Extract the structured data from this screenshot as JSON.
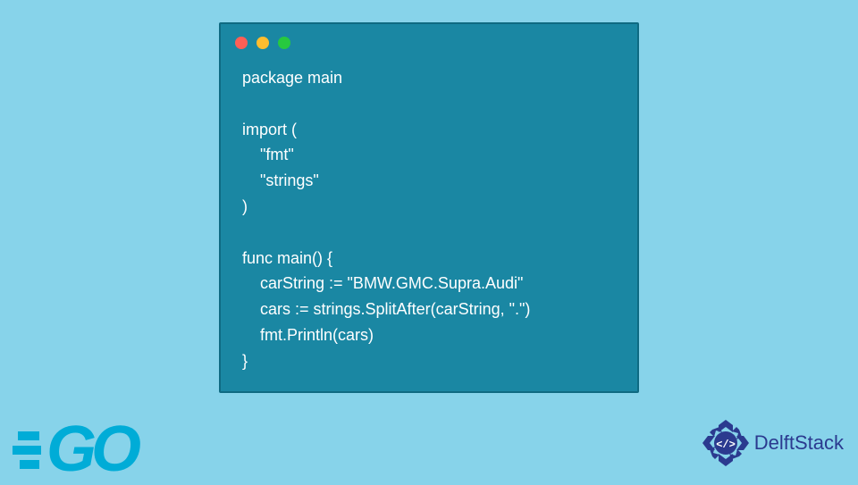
{
  "code": {
    "lines": [
      "package main",
      "",
      "import (",
      "    \"fmt\"",
      "    \"strings\"",
      ")",
      "",
      "func main() {",
      "    carString := \"BMW.GMC.Supra.Audi\"",
      "    cars := strings.SplitAfter(carString, \".\")",
      "    fmt.Println(cars)",
      "}"
    ]
  },
  "logos": {
    "go": "GO",
    "delft": "DelftStack",
    "delft_badge": "</>"
  },
  "colors": {
    "page_bg": "#87d3ea",
    "window_bg": "#1a87a3",
    "go_brand": "#00acd7",
    "delft_brand": "#2b3a8f"
  }
}
